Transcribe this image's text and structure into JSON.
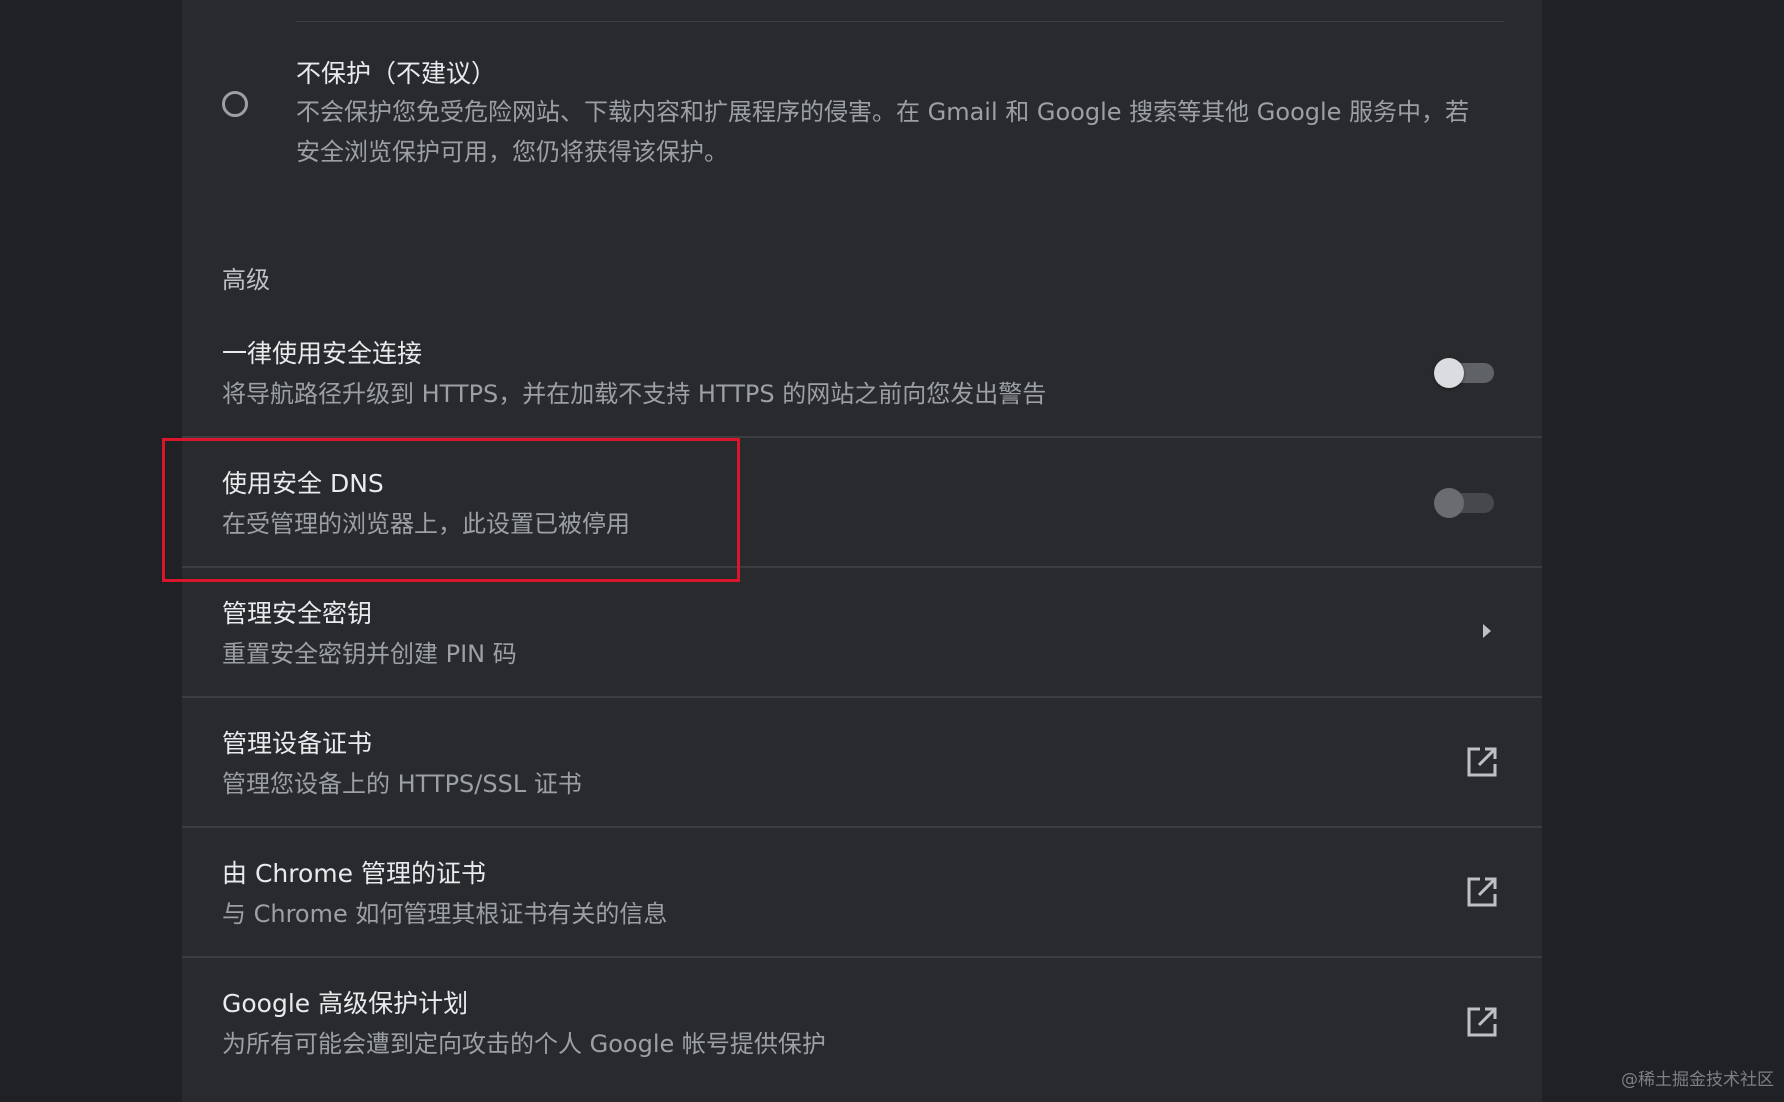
{
  "radio_option": {
    "title": "不保护（不建议）",
    "description": "不会保护您免受危险网站、下载内容和扩展程序的侵害。在 Gmail 和 Google 搜索等其他 Google 服务中，若安全浏览保护可用，您仍将获得该保护。",
    "selected": false
  },
  "advanced": {
    "heading": "高级",
    "rows": [
      {
        "title": "一律使用安全连接",
        "subtitle": "将导航路径升级到 HTTPS，并在加载不支持 HTTPS 的网站之前向您发出警告",
        "control": "toggle",
        "enabled": false
      },
      {
        "title": "使用安全 DNS",
        "subtitle": "在受管理的浏览器上，此设置已被停用",
        "control": "toggle",
        "enabled": false,
        "disabled": true
      },
      {
        "title": "管理安全密钥",
        "subtitle": "重置安全密钥并创建 PIN 码",
        "control": "chevron-right-icon"
      },
      {
        "title": "管理设备证书",
        "subtitle": "管理您设备上的 HTTPS/SSL 证书",
        "control": "external-link-icon"
      },
      {
        "title": "由 Chrome 管理的证书",
        "subtitle": "与 Chrome 如何管理其根证书有关的信息",
        "control": "external-link-icon"
      },
      {
        "title": "Google 高级保护计划",
        "subtitle": "为所有可能会遭到定向攻击的个人 Google 帐号提供保护",
        "control": "external-link-icon"
      }
    ]
  },
  "highlight_color": "#d9162b",
  "watermark": "@稀土掘金技术社区"
}
